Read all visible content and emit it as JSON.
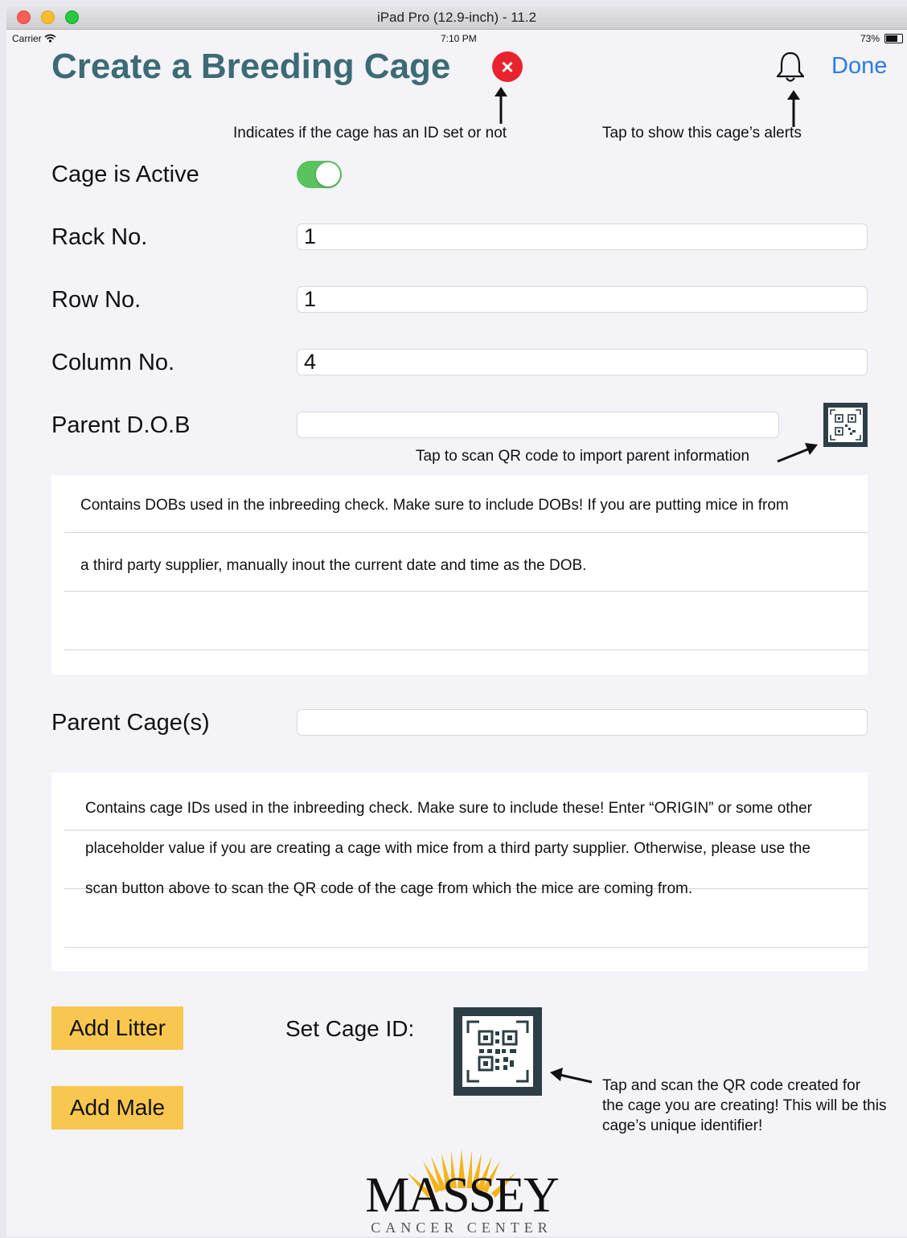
{
  "simulator": {
    "title": "iPad Pro (12.9-inch) - 11.2"
  },
  "status_bar": {
    "carrier": "Carrier",
    "time": "7:10 PM",
    "battery": "73%"
  },
  "header": {
    "title": "Create a Breeding Cage",
    "id_status_symbol": "×",
    "alerts_icon": "bell-icon",
    "done_label": "Done"
  },
  "annotations": {
    "id_indicator": "Indicates if the cage has an ID set or not",
    "alerts": "Tap to show this cage’s alerts",
    "scan_parent": "Tap to scan QR code to import parent information",
    "set_cage_id": [
      "Tap and scan the QR code created for",
      "the cage you are creating! This will be this",
      "cage’s unique identifier!"
    ]
  },
  "form": {
    "active_label": "Cage is Active",
    "active_value": true,
    "rack_label": "Rack No.",
    "rack_value": "1",
    "row_label": "Row No.",
    "row_value": "1",
    "column_label": "Column No.",
    "column_value": "4",
    "parent_dob_label": "Parent D.O.B",
    "parent_dob_value": "",
    "parent_cages_label": "Parent Cage(s)",
    "parent_cages_value": ""
  },
  "dob_notes": [
    "Contains DOBs used in the inbreeding check. Make sure to include DOBs! If you are putting mice in from",
    "a third party supplier, manually inout the current date and time as the DOB."
  ],
  "cage_notes": [
    "Contains cage IDs used in the inbreeding check. Make sure to include these! Enter “ORIGIN” or some other",
    "placeholder value if you are creating a cage with mice from a third party supplier. Otherwise, please use the",
    "scan button above to scan the QR code of the cage from which the mice are coming from."
  ],
  "actions": {
    "add_litter": "Add Litter",
    "add_male": "Add Male",
    "set_cage_id_label": "Set Cage ID:"
  },
  "logo": {
    "name": "MASSEY",
    "subtitle": "CANCER CENTER"
  },
  "colors": {
    "title": "#3c6b75",
    "accent_blue": "#2a7be4",
    "toggle_on": "#5ac35f",
    "button_yellow": "#f9c74f",
    "error_red": "#e8232f",
    "logo_gold": "#f5b51a"
  }
}
